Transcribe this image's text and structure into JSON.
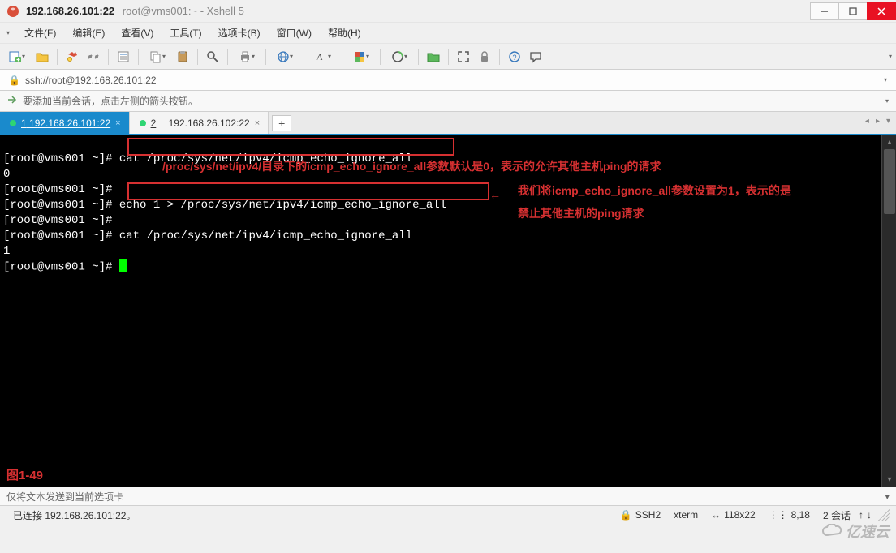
{
  "window": {
    "title_main": "192.168.26.101:22",
    "title_sub": "root@vms001:~ - Xshell 5"
  },
  "menu": {
    "file": "文件(F)",
    "edit": "编辑(E)",
    "view": "查看(V)",
    "tools": "工具(T)",
    "tabs": "选项卡(B)",
    "window": "窗口(W)",
    "help": "帮助(H)"
  },
  "address": {
    "url": "ssh://root@192.168.26.101:22"
  },
  "hint": {
    "text": "要添加当前会话，点击左侧的箭头按钮。"
  },
  "tabs": {
    "0": {
      "num": "1",
      "label": "192.168.26.101:22"
    },
    "1": {
      "num": "2",
      "label": "192.168.26.102:22"
    }
  },
  "terminal": {
    "lines": {
      "0": "[root@vms001 ~]# cat /proc/sys/net/ipv4/icmp_echo_ignore_all",
      "1": "0",
      "2": "[root@vms001 ~]# ",
      "3": "[root@vms001 ~]# echo 1 > /proc/sys/net/ipv4/icmp_echo_ignore_all",
      "4": "[root@vms001 ~]# ",
      "5": "[root@vms001 ~]# cat /proc/sys/net/ipv4/icmp_echo_ignore_all",
      "6": "1",
      "7": "[root@vms001 ~]# "
    },
    "annotations": {
      "a1": "/proc/sys/net/ipv4/目录下的icmp_echo_ignore_all参数默认是0，表示的允许其他主机ping的请求",
      "a2": "我们将icmp_echo_ignore_all参数设置为1，表示的是",
      "a3": "禁止其他主机的ping请求",
      "arrow": "←",
      "figure": "图1-49"
    }
  },
  "compose": {
    "placeholder": "仅将文本发送到当前选项卡"
  },
  "status": {
    "conn": "已连接 192.168.26.101:22。",
    "proto": "SSH2",
    "term": "xterm",
    "size": "118x22",
    "pos": "8,18",
    "sessions": "2 会话",
    "lock_icon": "🔒",
    "size_icon": "↔",
    "pos_icon": "⋮⋮",
    "sess_up": "↑",
    "sess_dn": "↓"
  },
  "watermark": {
    "text": "亿速云"
  }
}
